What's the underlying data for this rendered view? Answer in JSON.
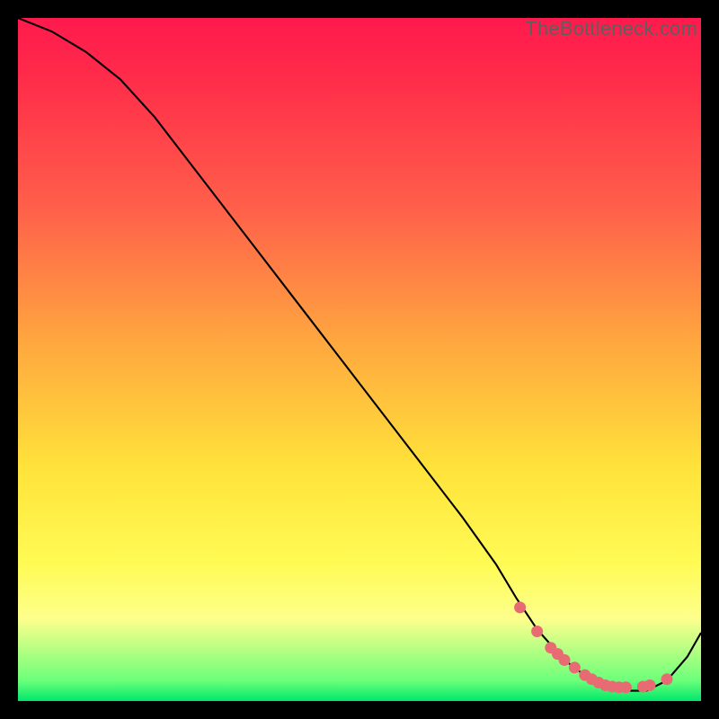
{
  "watermark": "TheBottleneck.com",
  "colors": {
    "dot": "#e86a72",
    "curve": "#000000"
  },
  "chart_data": {
    "type": "line",
    "title": "",
    "xlabel": "",
    "ylabel": "",
    "xlim": [
      0,
      100
    ],
    "ylim": [
      0,
      100
    ],
    "grid": false,
    "series": [
      {
        "name": "curve",
        "x": [
          0,
          5,
          10,
          15,
          20,
          25,
          30,
          35,
          40,
          45,
          50,
          55,
          60,
          65,
          70,
          73,
          76,
          80,
          84,
          88,
          92,
          95,
          98,
          100
        ],
        "y": [
          100,
          98,
          95,
          91,
          85.5,
          79,
          72.5,
          66,
          59.5,
          53,
          46.5,
          40,
          33.5,
          27,
          20,
          15,
          10.5,
          6,
          3,
          1.5,
          1.5,
          3,
          6.5,
          10
        ]
      }
    ],
    "dots": {
      "name": "highlight-dots",
      "x": [
        73.5,
        76,
        78,
        79,
        80,
        81.5,
        83,
        84,
        85,
        86,
        87,
        88,
        89,
        91.5,
        92.5,
        95
      ],
      "y": [
        13.7,
        10.2,
        7.8,
        6.9,
        6.0,
        4.9,
        3.8,
        3.2,
        2.7,
        2.3,
        2.1,
        2.0,
        2.0,
        2.1,
        2.3,
        3.2
      ]
    }
  }
}
